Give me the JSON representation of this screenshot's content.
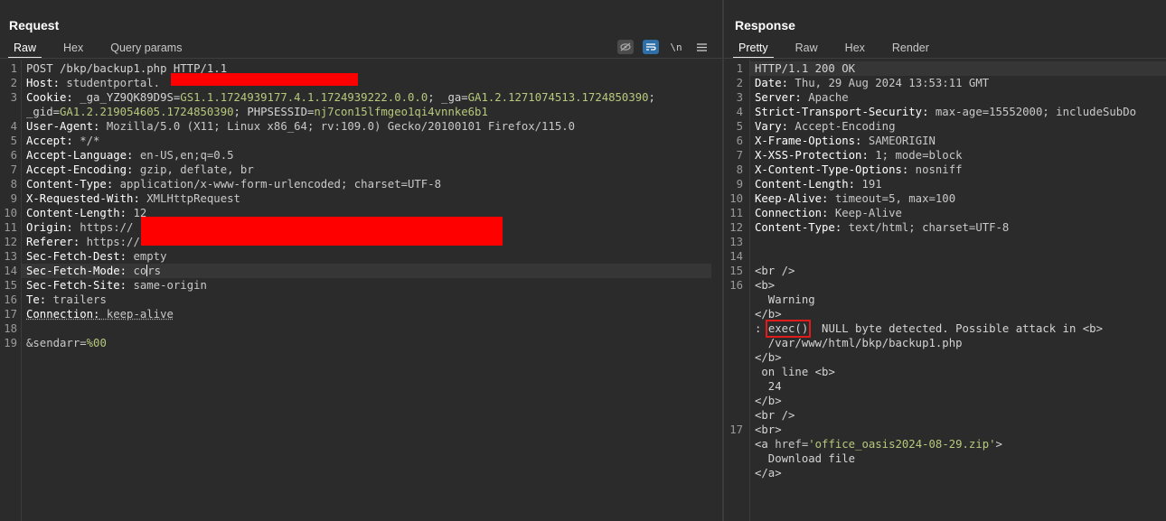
{
  "request": {
    "title": "Request",
    "tabs": [
      "Raw",
      "Hex",
      "Query params"
    ],
    "active_tab": "Raw",
    "toolbar": {
      "wrap_label": "\\n",
      "menu_icon": "hamburger-menu-icon",
      "hide_icon": "eye-off-icon",
      "pretty_icon": "text-wrap-icon"
    },
    "lines": {
      "l1": "POST /bkp/backup1.php HTTP/1.1",
      "l2_key": "Host:",
      "l2_val": " studentportal.",
      "l3_key": "Cookie:",
      "l3_a": " _ga_YZ9QK89D9S=",
      "l3_b": "GS1.1.1724939177.4.1.1724939222.0.0.0",
      "l3_c": "; _ga=",
      "l3_d": "GA1.2.1271074513.1724850390",
      "l3_e": ";",
      "l3w_a": "_gid=",
      "l3w_b": "GA1.2.219054605.1724850390",
      "l3w_c": "; PHPSESSID=",
      "l3w_d": "nj7con15lfmgeo1qi4vnnke6b1",
      "l4_key": "User-Agent:",
      "l4_val": " Mozilla/5.0 (X11; Linux x86_64; rv:109.0) Gecko/20100101 Firefox/115.0",
      "l5_key": "Accept:",
      "l5_val": " */*",
      "l6_key": "Accept-Language:",
      "l6_val": " en-US,en;q=0.5",
      "l7_key": "Accept-Encoding:",
      "l7_val": " gzip, deflate, br",
      "l8_key": "Content-Type:",
      "l8_val": " application/x-www-form-urlencoded; charset=UTF-8",
      "l9_key": "X-Requested-With:",
      "l9_val": " XMLHttpRequest",
      "l10_key": "Content-Length:",
      "l10_val": " 12",
      "l11_key": "Origin:",
      "l11_val": " https://",
      "l12_key": "Referer:",
      "l12_val": " https://",
      "l13_key": "Sec-Fetch-Dest:",
      "l13_val": " empty",
      "l14_key": "Sec-Fetch-Mode:",
      "l14_val_a": " co",
      "l14_val_b": "rs",
      "l15_key": "Sec-Fetch-Site:",
      "l15_val": " same-origin",
      "l16_key": "Te:",
      "l16_val": " trailers",
      "l17_key": "Connection:",
      "l17_val": " keep-alive",
      "l19_a": "&sendarr=",
      "l19_b": "%00"
    },
    "line_numbers": [
      "1",
      "2",
      "3",
      "4",
      "5",
      "6",
      "7",
      "8",
      "9",
      "10",
      "11",
      "12",
      "13",
      "14",
      "15",
      "16",
      "17",
      "18",
      "19"
    ]
  },
  "response": {
    "title": "Response",
    "tabs": [
      "Pretty",
      "Raw",
      "Hex",
      "Render"
    ],
    "active_tab": "Pretty",
    "lines": {
      "l1": "HTTP/1.1 200 OK",
      "l2_key": "Date:",
      "l2_val": " Thu, 29 Aug 2024 13:53:11 GMT",
      "l3_key": "Server:",
      "l3_val": " Apache",
      "l4_key": "Strict-Transport-Security:",
      "l4_val": " max-age=15552000; includeSubDo",
      "l5_key": "Vary:",
      "l5_val": " Accept-Encoding",
      "l6_key": "X-Frame-Options:",
      "l6_val": " SAMEORIGIN",
      "l7_key": "X-XSS-Protection:",
      "l7_val": " 1; mode=block",
      "l8_key": "X-Content-Type-Options:",
      "l8_val": " nosniff",
      "l9_key": "Content-Length:",
      "l9_val": " 191",
      "l10_key": "Keep-Alive:",
      "l10_val": " timeout=5, max=100",
      "l11_key": "Connection:",
      "l11_val": " Keep-Alive",
      "l12_key": "Content-Type:",
      "l12_val": " text/html; charset=UTF-8",
      "b1": "<br />",
      "b2": "<b>",
      "b3": "  Warning",
      "b4": "</b>",
      "b5_a": ": ",
      "b5_exec": "exec()",
      "b5_b": "  NULL byte detected. Possible attack in ",
      "b5_c": "<b>",
      "b6": "  /var/www/html/bkp/backup1.php",
      "b7": "</b>",
      "b8_a": " on line ",
      "b8_b": "<b>",
      "b9": "  24",
      "b10": "</b>",
      "b11": "<br />",
      "b12": "<br>",
      "b13_a": "<a ",
      "b13_b": "href=",
      "b13_c": "'office_oasis2024-08-29.zip'",
      "b13_d": ">",
      "b14": "  Download file",
      "b15": "</a>"
    },
    "line_numbers": [
      "1",
      "2",
      "3",
      "4",
      "5",
      "6",
      "7",
      "8",
      "9",
      "10",
      "11",
      "12",
      "13",
      "14",
      "15",
      "16",
      "17"
    ]
  }
}
